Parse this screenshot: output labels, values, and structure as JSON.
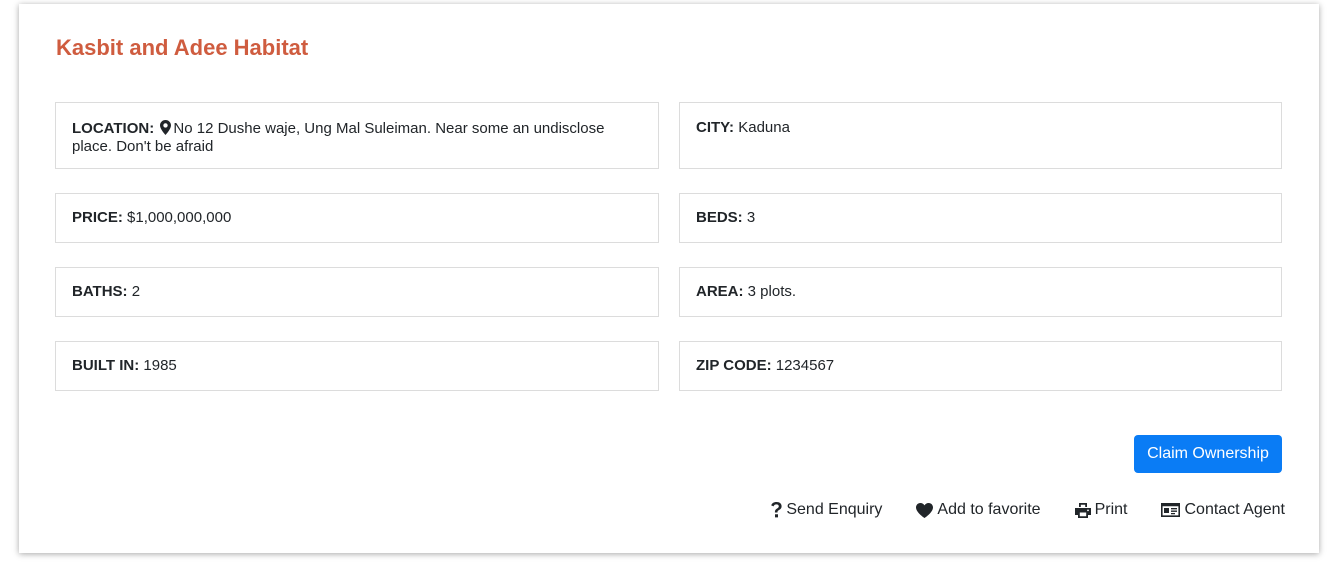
{
  "listing": {
    "title": "Kasbit and Adee Habitat",
    "location_label": "LOCATION:",
    "location_value": "No 12 Dushe waje, Ung Mal Suleiman. Near some an undisclose place. Don't be afraid",
    "city_label": "CITY:",
    "city_value": "Kaduna",
    "price_label": "PRICE:",
    "price_value": "$1,000,000,000",
    "beds_label": "BEDS:",
    "beds_value": "3",
    "baths_label": "BATHS:",
    "baths_value": "2",
    "area_label": "AREA:",
    "area_value": "3 plots.",
    "built_label": "BUILT IN:",
    "built_value": "1985",
    "zip_label": "ZIP CODE:",
    "zip_value": "1234567"
  },
  "buttons": {
    "claim": "Claim Ownership"
  },
  "actions": {
    "enquiry": "Send Enquiry",
    "favorite": "Add to favorite",
    "print": "Print",
    "contact": "Contact Agent"
  },
  "icons": {
    "location": "map-marker-icon",
    "enquiry": "question-icon",
    "favorite": "heart-icon",
    "print": "print-icon",
    "contact": "id-card-icon"
  },
  "colors": {
    "title": "#cf5c3f",
    "button": "#0a7cf5"
  }
}
